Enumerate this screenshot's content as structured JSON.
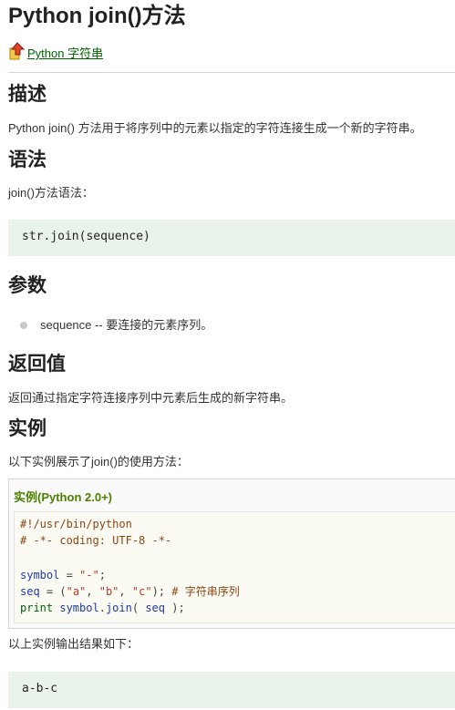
{
  "title": "Python join()方法",
  "back_link": {
    "icon": "up-arrow-icon",
    "label": " Python 字符串"
  },
  "sections": {
    "desc": {
      "heading": "描述",
      "text": "Python join() 方法用于将序列中的元素以指定的字符连接生成一个新的字符串。"
    },
    "syntax": {
      "heading": "语法",
      "intro": "join()方法语法：",
      "code": "str.join(sequence)"
    },
    "params": {
      "heading": "参数",
      "items": [
        "sequence -- 要连接的元素序列。"
      ]
    },
    "returns": {
      "heading": "返回值",
      "text": "返回通过指定字符连接序列中元素后生成的新字符串。"
    },
    "example": {
      "heading": "实例",
      "intro": "以下实例展示了join()的使用方法：",
      "box_title": "实例(Python 2.0+)",
      "code_lines": {
        "l1": "#!/usr/bin/python",
        "l2": "# -*- coding: UTF-8 -*-",
        "l4_var": "symbol",
        "l4_op": " = ",
        "l4_str": "\"-\"",
        "l4_end": ";",
        "l5_var": "seq",
        "l5_op": " = (",
        "l5_s1": "\"a\"",
        "l5_c1": ", ",
        "l5_s2": "\"b\"",
        "l5_c2": ", ",
        "l5_s3": "\"c\"",
        "l5_end": "); ",
        "l5_comment": "# 字符串序列",
        "l6_kw": "print",
        "l6_sp": " ",
        "l6_obj": "symbol",
        "l6_dot": ".",
        "l6_fn": "join",
        "l6_open": "( ",
        "l6_arg": "seq",
        "l6_close": " );"
      },
      "output_intro": "以上实例输出结果如下：",
      "output": "a-b-c"
    }
  },
  "colors": {
    "link": "#006600",
    "code_bg": "#eaf3ea",
    "example_title": "#4b8000"
  }
}
